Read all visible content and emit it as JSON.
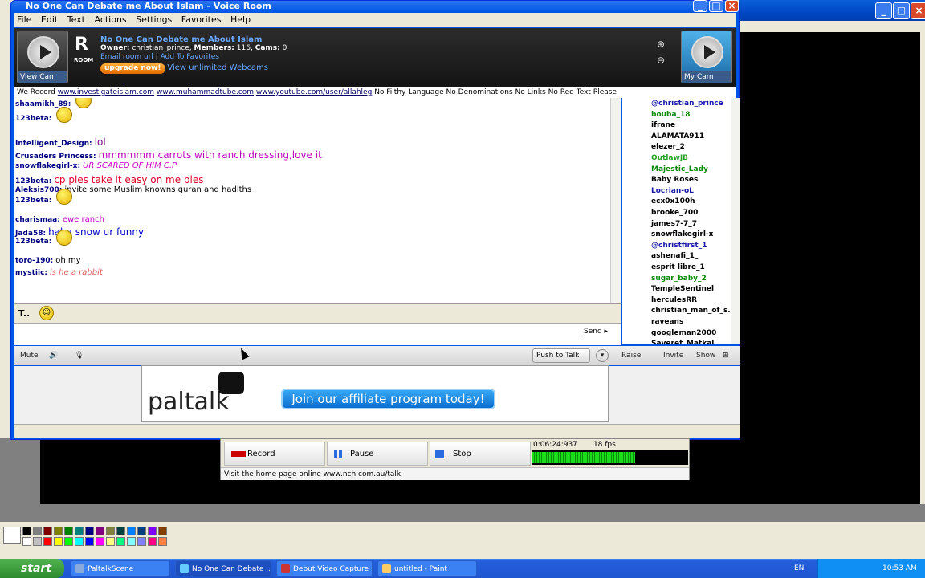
{
  "window": {
    "title": "No One Can Debate me About Islam - Voice Room"
  },
  "menu": [
    "File",
    "Edit",
    "Text",
    "Actions",
    "Settings",
    "Favorites",
    "Help"
  ],
  "room": {
    "view_cam": "View Cam",
    "my_cam": "My Cam",
    "letter": "R",
    "word": "ROOM",
    "name": "No One Can Debate me About Islam",
    "owner_label": "Owner:",
    "owner": "christian_prince",
    "members_label": "Members:",
    "members": "116",
    "cams_label": "Cams:",
    "cams": "0",
    "email_link": "Email room url",
    "favorites_link": "Add To Favorites",
    "upgrade": "upgrade now!",
    "webcams": "View unlimited Webcams"
  },
  "announce": {
    "prefix": "We Record",
    "link1": "www.investigateislam.com",
    "link2": "www.muhammadtube.com",
    "link3": "www.youtube.com/user/allahleg",
    "rules": "No Filthy Language No Denominations No Links No Red Text Please"
  },
  "chat": [
    {
      "nick": "shaamikh_89:",
      "text": "",
      "emote": true,
      "color": "#000000"
    },
    {
      "nick": "123beta:",
      "text": "",
      "emote": true,
      "color": "#000000"
    },
    {
      "nick": "Intelligent_Design:",
      "text": "lol",
      "color": "#7a0080"
    },
    {
      "nick": "Crusaders Princess:",
      "text": "mmmmmm carrots with ranch dressing,love it",
      "color": "#c000c0"
    },
    {
      "nick": "snowflakegirl-x:",
      "text": "UR SCARED OF HIM C.P",
      "color": "#cc00cc"
    },
    {
      "nick": "123beta:",
      "text": "cp ples take it easy on me ples",
      "color": "#e0002a"
    },
    {
      "nick": "Aleksis700:",
      "text": "invite some Muslim knowns quran and hadiths",
      "color": "#000000"
    },
    {
      "nick": "123beta:",
      "text": "",
      "emote": true,
      "color": "#000000"
    },
    {
      "nick": "charismaa:",
      "text": "ewe ranch",
      "color": "#c000c0"
    },
    {
      "nick": "Jada58:",
      "text": "haha snow ur funny",
      "color": "#0000cc"
    },
    {
      "nick": "123beta:",
      "text": "",
      "emote": true,
      "color": "#000000"
    },
    {
      "nick": "toro-190:",
      "text": "oh my",
      "color": "#000000"
    },
    {
      "nick": "mystiic:",
      "text": "is he a rabbit",
      "color": "#e06060"
    }
  ],
  "users": [
    {
      "name": "@christian_prince",
      "color": "#1a1aa8"
    },
    {
      "name": "bouba_18",
      "color": "#0a8a0a"
    },
    {
      "name": "ifrane",
      "color": "#000000"
    },
    {
      "name": "ALAMATA911",
      "color": "#000000"
    },
    {
      "name": "elezer_2",
      "color": "#000000"
    },
    {
      "name": "OutlawJB",
      "color": "#2aa02a"
    },
    {
      "name": "Majestic_Lady",
      "color": "#0a8a0a"
    },
    {
      "name": "Baby Roses",
      "color": "#000000"
    },
    {
      "name": "Locrian-oL",
      "color": "#1a1aa8"
    },
    {
      "name": "ecx0x100h",
      "color": "#000000"
    },
    {
      "name": "brooke_700",
      "color": "#000000"
    },
    {
      "name": "james7-7_7",
      "color": "#000000"
    },
    {
      "name": "snowflakegirl-x",
      "color": "#000000"
    },
    {
      "name": "@christfirst_1",
      "color": "#1a1aa8"
    },
    {
      "name": "ashenafi_1_",
      "color": "#000000"
    },
    {
      "name": "esprit libre_1",
      "color": "#000000"
    },
    {
      "name": "sugar_baby_2",
      "color": "#0a8a0a"
    },
    {
      "name": "TempleSentinel",
      "color": "#000000"
    },
    {
      "name": "herculesRR",
      "color": "#000000"
    },
    {
      "name": "christian_man_of_s...",
      "color": "#000000"
    },
    {
      "name": "raveans",
      "color": "#000000"
    },
    {
      "name": "googleman2000",
      "color": "#000000"
    },
    {
      "name": "Saveret_Matkal",
      "color": "#000000"
    }
  ],
  "controls": {
    "send": "Send ▸",
    "mute": "Mute",
    "push_to_talk": "Push to Talk",
    "raise": "Raise",
    "invite": "Invite",
    "show": "Show",
    "text_tool": "T..",
    "emoticon_tool": "☺"
  },
  "ad": {
    "logo": "paltalk",
    "cta": "Join our affiliate program today!"
  },
  "recorder": {
    "record": "Record",
    "pause": "Pause",
    "stop": "Stop",
    "time": "0:06:24:937",
    "fps": "18 fps",
    "level": 0.66,
    "status": "Visit the home page online www.nch.com.au/talk"
  },
  "taskbar": {
    "start": "start",
    "tasks": [
      "PaltalkScene",
      "No One Can Debate ...",
      "Debut Video Capture ...",
      "untitled - Paint"
    ],
    "lang": "EN",
    "clock": "10:53 AM"
  }
}
